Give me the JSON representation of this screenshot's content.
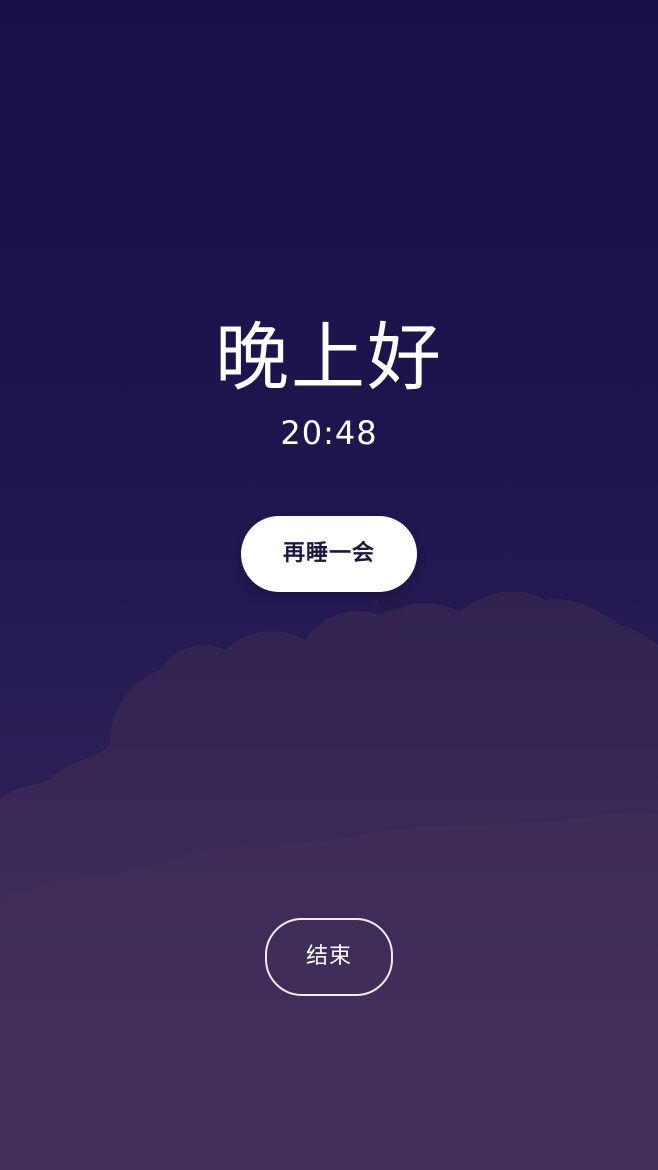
{
  "alarm": {
    "greeting": "晚上好",
    "time": "20:48",
    "snooze_label": "再睡一会",
    "end_label": "结束"
  },
  "theme": {
    "background_top": "#170f45",
    "background_bottom": "#33244f",
    "cloud_color": "#3d2a57",
    "button_fill": "#ffffff",
    "button_text": "#1d1640"
  }
}
